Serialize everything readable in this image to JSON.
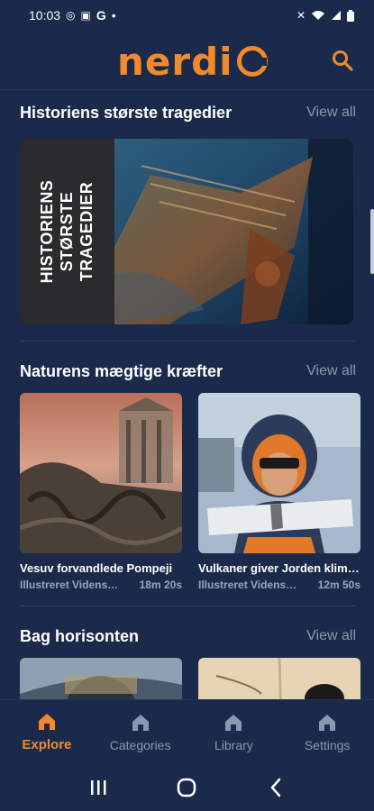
{
  "status": {
    "time": "10:03",
    "g": "G",
    "dot": "•"
  },
  "app": {
    "logo_text": "nerdi",
    "search_icon": "search-icon",
    "accent": "#f08a2c",
    "background": "#1b2a4a"
  },
  "sections": [
    {
      "title": "Historiens største tragedier",
      "view_all": "View all",
      "feature_line1": "HISTORIENS",
      "feature_line2": "STØRSTE",
      "feature_line3": "TRAGEDIER"
    },
    {
      "title": "Naturens mægtige kræfter",
      "view_all": "View all",
      "items": [
        {
          "title": "Vesuv forvandlede Pompeji",
          "source": "Illustreret Videnskab",
          "duration": "18m 20s"
        },
        {
          "title": "Vulkaner giver Jorden klimaet",
          "source": "Illustreret Videnskab",
          "duration": "12m 50s"
        }
      ]
    },
    {
      "title": "Bag horisonten",
      "view_all": "View all"
    }
  ],
  "nav": {
    "items": [
      {
        "label": "Explore",
        "icon": "home-icon",
        "active": true
      },
      {
        "label": "Categories",
        "icon": "home-icon",
        "active": false
      },
      {
        "label": "Library",
        "icon": "home-icon",
        "active": false
      },
      {
        "label": "Settings",
        "icon": "home-icon",
        "active": false
      }
    ]
  }
}
